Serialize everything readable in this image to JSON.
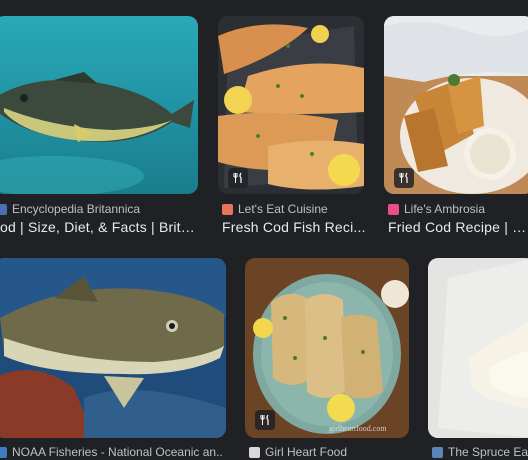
{
  "results": [
    {
      "source": "Encyclopedia Britannica",
      "title": "od | Size, Diet, & Facts | Brita...",
      "favicon_color": "#4a6fb5"
    },
    {
      "source": "Let's Eat Cuisine",
      "title": "Fresh Cod Fish Reci...",
      "favicon_color": "#e8745a"
    },
    {
      "source": "Life's Ambrosia",
      "title": "Fried Cod Recipe | L...",
      "favicon_color": "#e94e8a"
    },
    {
      "source": "NOAA Fisheries - National Oceanic an...",
      "title": "",
      "favicon_color": "#3f7cc4"
    },
    {
      "source": "Girl Heart Food",
      "title": "",
      "favicon_color": "#d9d9d9"
    },
    {
      "source": "The Spruce Ea",
      "title": "",
      "favicon_color": "#5a86b8"
    }
  ],
  "image_watermark": "girlheartfood.com",
  "icons": {
    "recipe_badge": "fork-knife-icon"
  }
}
